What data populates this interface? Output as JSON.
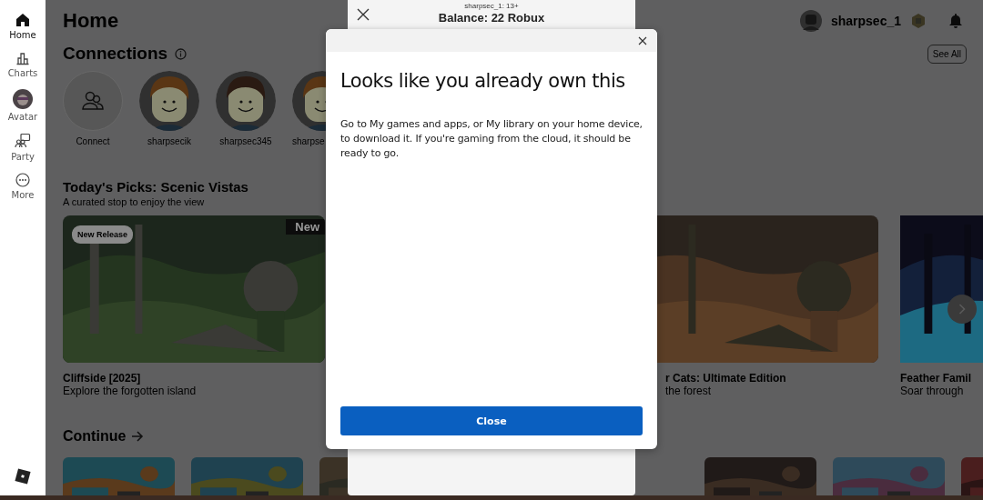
{
  "sidebar": {
    "items": [
      {
        "kind": "home",
        "label": "Home",
        "selected": true
      },
      {
        "kind": "charts",
        "label": "Charts",
        "selected": false
      },
      {
        "kind": "avatar",
        "label": "Avatar",
        "selected": false
      },
      {
        "kind": "party",
        "label": "Party",
        "selected": false
      },
      {
        "kind": "more",
        "label": "More",
        "selected": false
      }
    ]
  },
  "header": {
    "title": "Home",
    "username": "sharpsec_1"
  },
  "connections": {
    "title": "Connections",
    "see_all": "See All",
    "items": [
      {
        "kind": "add",
        "label": "Connect"
      },
      {
        "kind": "friend",
        "label": "sharpsecik"
      },
      {
        "kind": "friend",
        "label": "sharpsec345"
      },
      {
        "kind": "friend",
        "label": "sharpse"
      }
    ]
  },
  "picks": {
    "title": "Today's Picks: Scenic Vistas",
    "subtitle": "A curated stop to enjoy the view",
    "cards": [
      {
        "title": "Cliffside [2025]",
        "subtitle": "Explore the forgotten island",
        "badge": "New Release",
        "tag": "New"
      },
      {
        "title": "r Cats: Ultimate Edition",
        "subtitle": "the forest"
      },
      {
        "title": "Feather Famil",
        "subtitle": "Soar through"
      }
    ]
  },
  "continue": {
    "title": "Continue"
  },
  "purchase_panel": {
    "account": "sharpsec_1: 13+",
    "balance": "Balance: 22 Robux"
  },
  "dialog": {
    "title": "Looks like you already own this",
    "message": "Go to My games and apps, or My library on your home device, to download it. If you're gaming from the cloud, it should be ready to go.",
    "button": "Close"
  }
}
